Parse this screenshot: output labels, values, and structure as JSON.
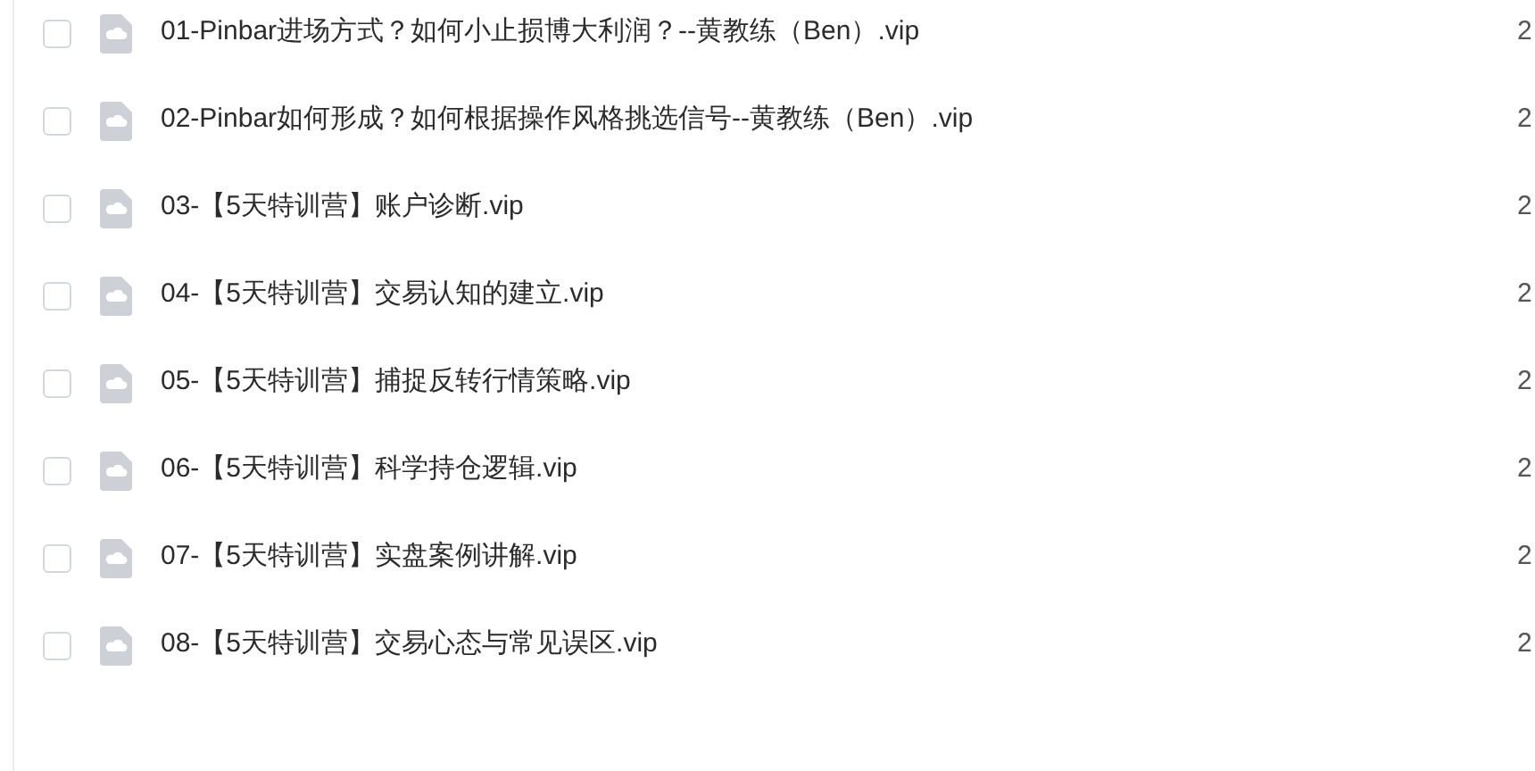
{
  "files": [
    {
      "name": "01-Pinbar进场方式？如何小止损博大利润？--黄教练（Ben）.vip",
      "checked": false,
      "column_2": "2"
    },
    {
      "name": "02-Pinbar如何形成？如何根据操作风格挑选信号--黄教练（Ben）.vip",
      "checked": false,
      "column_2": "2"
    },
    {
      "name": "03-【5天特训营】账户诊断.vip",
      "checked": false,
      "column_2": "2"
    },
    {
      "name": "04-【5天特训营】交易认知的建立.vip",
      "checked": false,
      "column_2": "2"
    },
    {
      "name": "05-【5天特训营】捕捉反转行情策略.vip",
      "checked": false,
      "column_2": "2"
    },
    {
      "name": "06-【5天特训营】科学持仓逻辑.vip",
      "checked": false,
      "column_2": "2"
    },
    {
      "name": "07-【5天特训营】实盘案例讲解.vip",
      "checked": false,
      "column_2": "2"
    },
    {
      "name": "08-【5天特训营】交易心态与常见误区.vip",
      "checked": false,
      "column_2": "2"
    }
  ]
}
